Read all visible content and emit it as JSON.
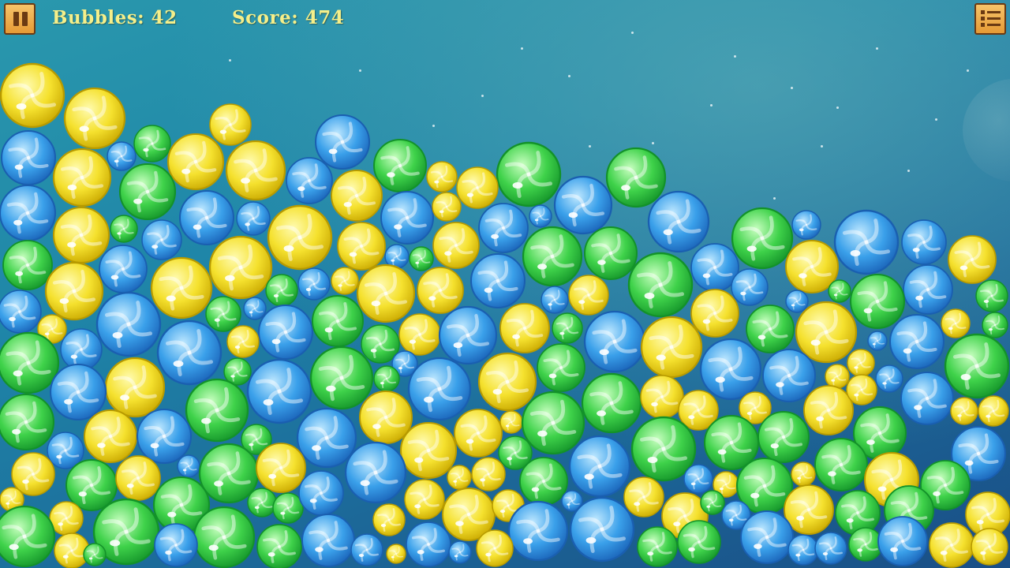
{
  "hud": {
    "bubbles_label": "Bubbles:",
    "bubbles_count": "42",
    "score_label": "Score:",
    "score_value": "474",
    "pause_icon": "pause-icon",
    "menu_icon": "list-menu-icon"
  },
  "colors": {
    "hud_text": "#f5ef8a",
    "button_fill": "#efb04e",
    "button_border": "#6b3a12",
    "background_top": "#2a98ad",
    "background_bottom": "#1a4e86",
    "bubble_yellow": "#f5e12e",
    "bubble_blue": "#3aa0ea",
    "bubble_green": "#3fd24a"
  },
  "bubble_colors": [
    "yellow",
    "blue",
    "green"
  ]
}
